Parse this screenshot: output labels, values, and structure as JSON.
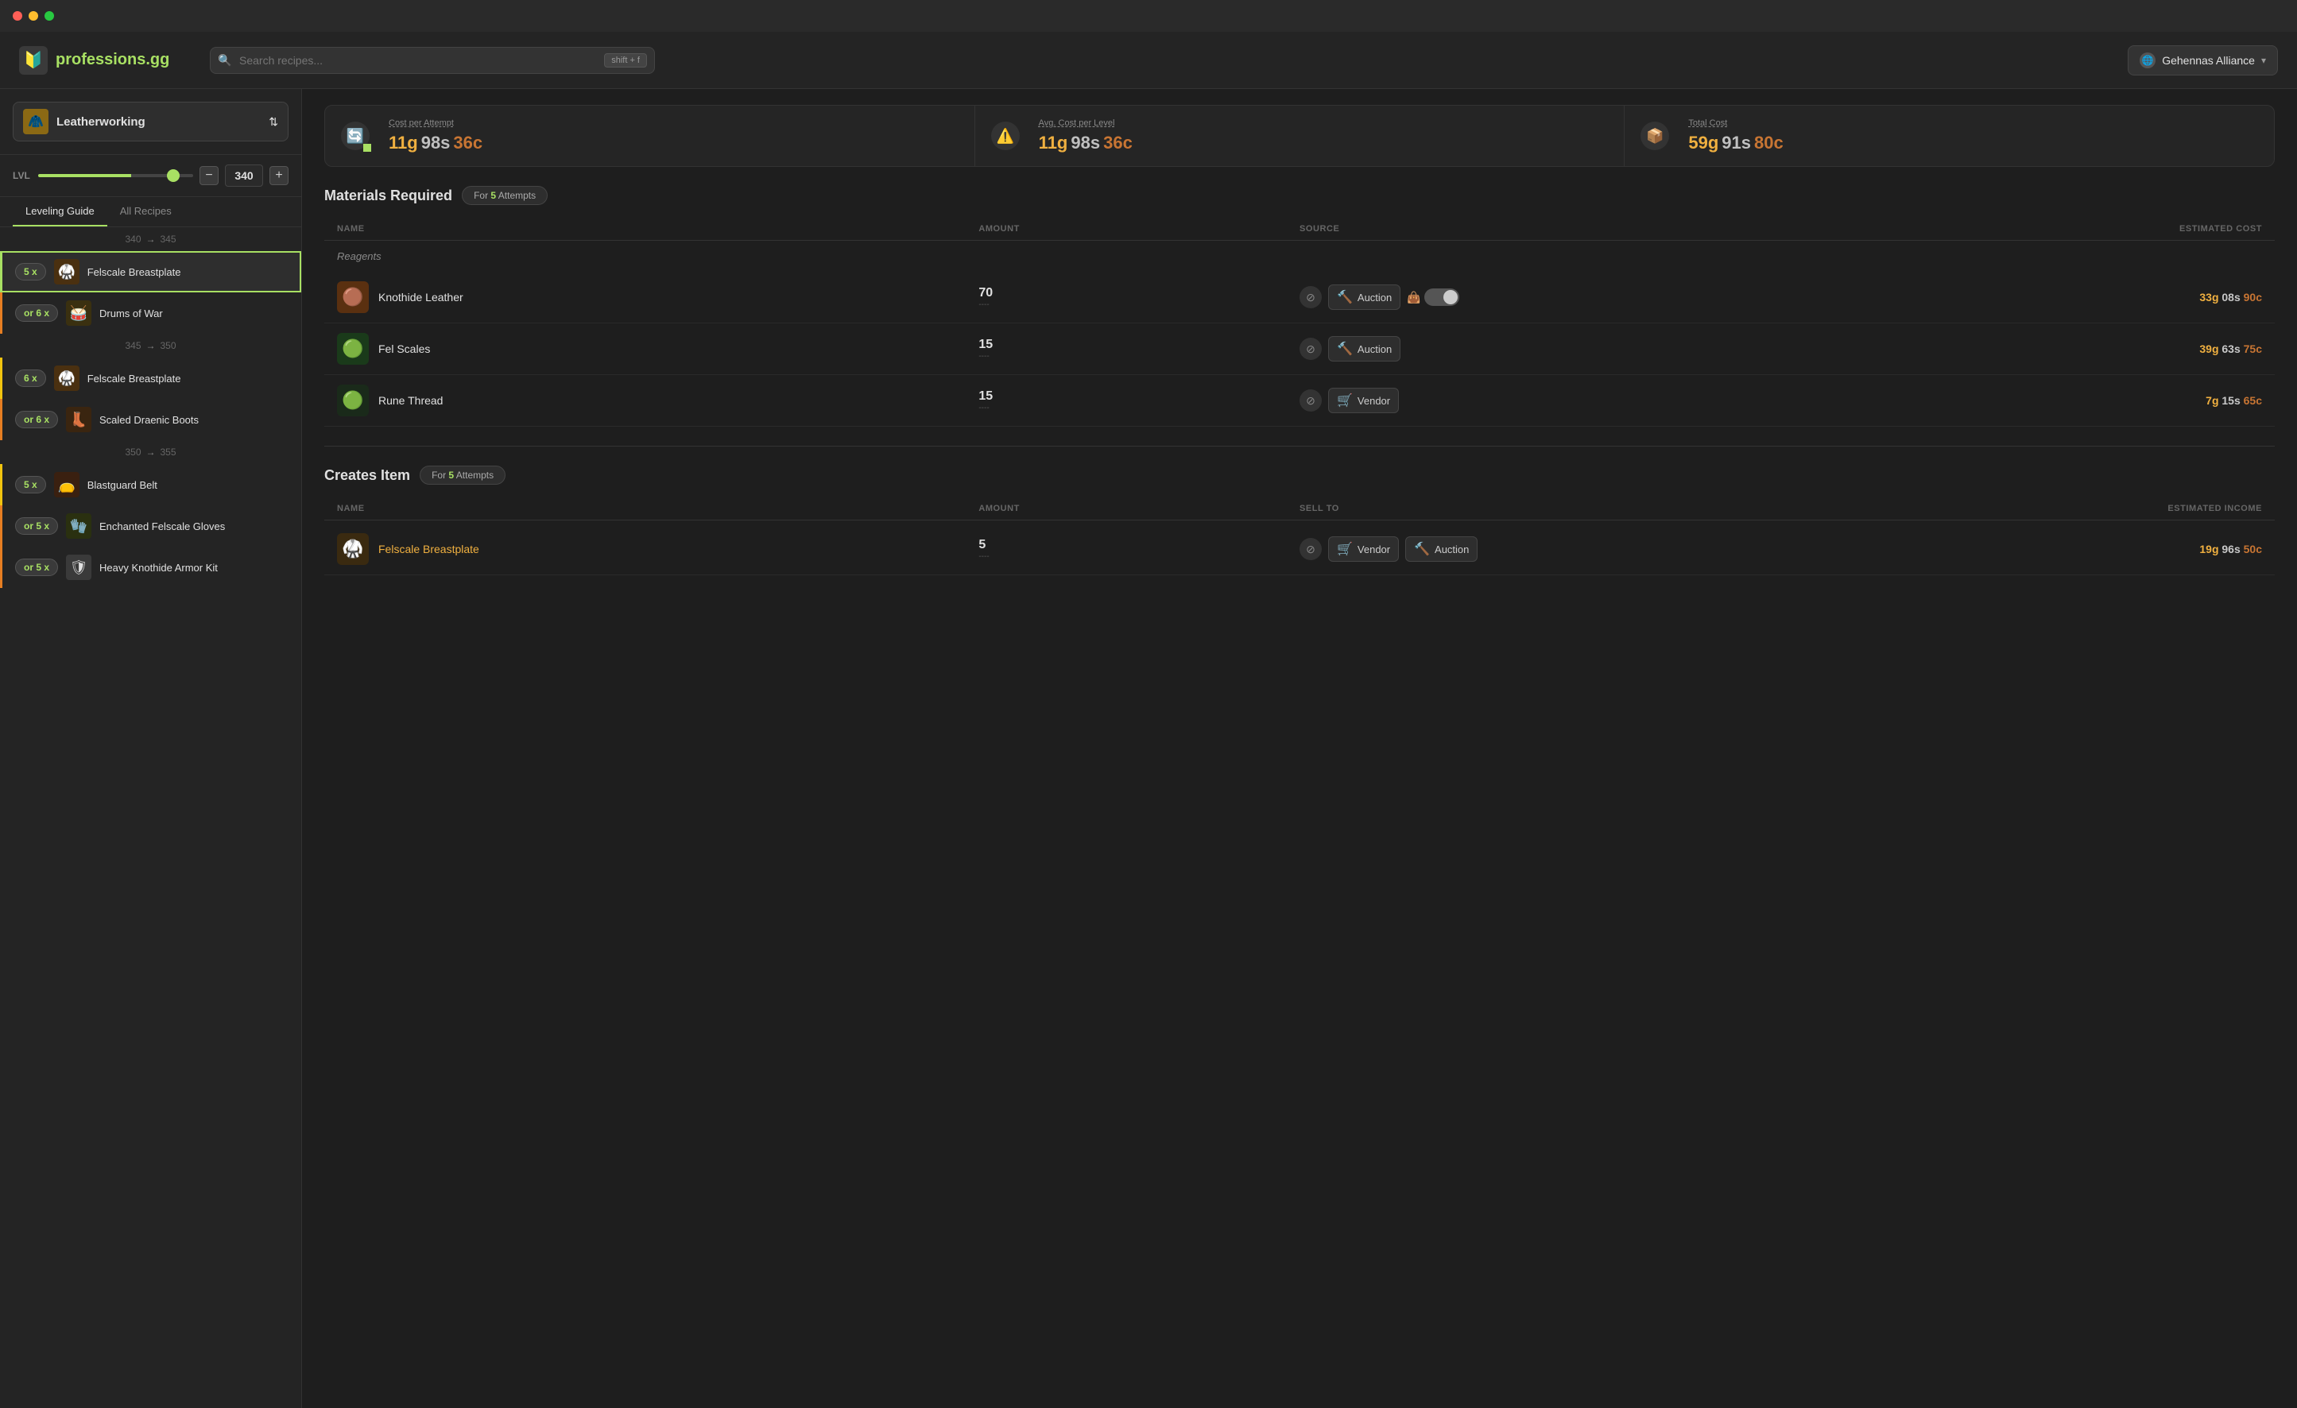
{
  "titleBar": {
    "trafficLights": [
      "red",
      "yellow",
      "green"
    ]
  },
  "header": {
    "logo": {
      "icon": "🔰",
      "textBefore": "professions",
      "textAfter": ".gg"
    },
    "search": {
      "placeholder": "Search recipes...",
      "shortcut": "shift + f"
    },
    "realm": {
      "name": "Gehennas Alliance"
    }
  },
  "sidebar": {
    "profession": {
      "icon": "🧥",
      "name": "Leatherworking"
    },
    "level": {
      "label": "LVL",
      "value": "340",
      "min": 0,
      "max": 375,
      "percent": 90
    },
    "tabs": [
      {
        "label": "Leveling Guide",
        "active": true
      },
      {
        "label": "All Recipes",
        "active": false
      }
    ],
    "sections": [
      {
        "type": "divider",
        "from": "340",
        "to": "345"
      },
      {
        "type": "recipe",
        "count": "5 x",
        "name": "Felscale Breastplate",
        "icon": "🥋",
        "active": true,
        "color": "yellow"
      },
      {
        "type": "recipe",
        "count": "or 6 x",
        "name": "Drums of War",
        "icon": "🥁",
        "active": false,
        "color": "orange"
      },
      {
        "type": "divider",
        "from": "345",
        "to": "350"
      },
      {
        "type": "recipe",
        "count": "6 x",
        "name": "Felscale Breastplate",
        "icon": "🥋",
        "active": false,
        "color": "yellow"
      },
      {
        "type": "recipe",
        "count": "or 6 x",
        "name": "Scaled Draenic Boots",
        "icon": "👢",
        "active": false,
        "color": "orange"
      },
      {
        "type": "divider",
        "from": "350",
        "to": "355"
      },
      {
        "type": "recipe",
        "count": "5 x",
        "name": "Blastguard Belt",
        "icon": "👝",
        "active": false,
        "color": "yellow"
      },
      {
        "type": "recipe",
        "count": "or 5 x",
        "name": "Enchanted Felscale Gloves",
        "icon": "🧤",
        "active": false,
        "color": "orange"
      },
      {
        "type": "recipe",
        "count": "or 5 x",
        "name": "Heavy Knothide Armor Kit",
        "icon": "🛡",
        "active": false,
        "color": "orange"
      }
    ]
  },
  "content": {
    "stats": [
      {
        "label": "Cost per Attempt",
        "icon": "🔄",
        "iconColor": "#a8e063",
        "gold": "11g",
        "silver": "98s",
        "copper": "36c"
      },
      {
        "label": "Avg. Cost per Level",
        "icon": "⚠️",
        "iconColor": "#e0e000",
        "gold": "11g",
        "silver": "98s",
        "copper": "36c"
      },
      {
        "label": "Total Cost",
        "icon": "📦",
        "iconColor": "#a0c0ff",
        "gold": "59g",
        "silver": "91s",
        "copper": "80c"
      }
    ],
    "materialsSection": {
      "title": "Materials Required",
      "badge": "For 5 Attempts",
      "badgeHighlight": "5",
      "columns": [
        "NAME",
        "AMOUNT",
        "SOURCE",
        "ESTIMATED COST"
      ],
      "subSection": "Reagents",
      "items": [
        {
          "name": "Knothide Leather",
          "icon": "🟤",
          "iconBg": "#5a3010",
          "amount": "70",
          "hasBan": true,
          "source": "Auction",
          "sourceIcon": "🔨",
          "hasToggle": true,
          "toggleOn": true,
          "gold": "33g",
          "silver": "08s",
          "copper": "90c"
        },
        {
          "name": "Fel Scales",
          "icon": "🟢",
          "iconBg": "#1a3a1a",
          "amount": "15",
          "hasBan": true,
          "source": "Auction",
          "sourceIcon": "🔨",
          "hasToggle": false,
          "gold": "39g",
          "silver": "63s",
          "copper": "75c"
        },
        {
          "name": "Rune Thread",
          "icon": "🟢",
          "iconBg": "#1a2a1a",
          "amount": "15",
          "hasBan": true,
          "source": "Vendor",
          "sourceIcon": "🛒",
          "hasToggle": false,
          "gold": "7g",
          "silver": "15s",
          "copper": "65c"
        }
      ]
    },
    "createsSection": {
      "title": "Creates Item",
      "badge": "For 5 Attempts",
      "badgeHighlight": "5",
      "columns": [
        "NAME",
        "AMOUNT",
        "SELL TO",
        "ESTIMATED INCOME"
      ],
      "items": [
        {
          "name": "Felscale Breastplate",
          "icon": "🥋",
          "iconBg": "#3a2a10",
          "amount": "5",
          "isGold": true,
          "hasBan": true,
          "sellTo1": "Vendor",
          "sellTo1Icon": "🛒",
          "sellTo2": "Auction",
          "sellTo2Icon": "🔨",
          "gold": "19g",
          "silver": "96s",
          "copper": "50c"
        }
      ]
    }
  }
}
